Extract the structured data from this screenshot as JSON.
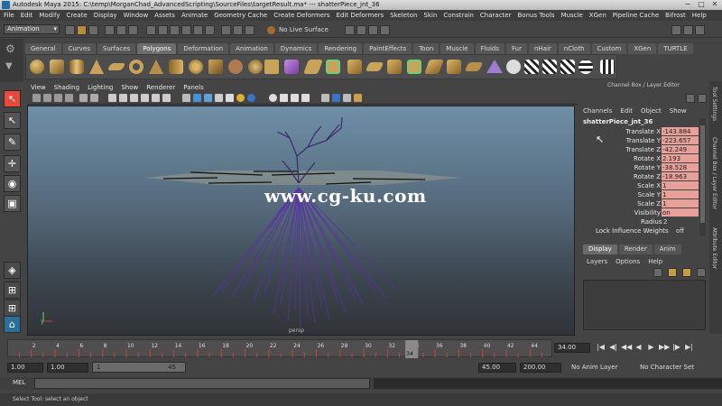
{
  "window": {
    "title": "Autodesk Maya 2015: C:\\temp\\MorganChad_AdvancedScripting\\SourceFiles\\targetResult.ma*  ---  shatterPiece_jnt_36",
    "controls": [
      "−",
      "□",
      "✕"
    ]
  },
  "menubar": [
    "File",
    "Edit",
    "Modify",
    "Create",
    "Display",
    "Window",
    "Assets",
    "Animate",
    "Geometry Cache",
    "Create Deformers",
    "Edit Deformers",
    "Skeleton",
    "Skin",
    "Constrain",
    "Character",
    "Bonus Tools",
    "Muscle",
    "XGen",
    "Pipeline Cache",
    "Bifrost",
    "Help"
  ],
  "statusline": {
    "mode": "Animation",
    "live_surface": "No Live Surface"
  },
  "shelf": {
    "tabs": [
      "General",
      "Curves",
      "Surfaces",
      "Polygons",
      "Deformation",
      "Animation",
      "Dynamics",
      "Rendering",
      "PaintEffects",
      "Toon",
      "Muscle",
      "Fluids",
      "Fur",
      "nHair",
      "nCloth",
      "Custom",
      "XGen",
      "TURTLE"
    ],
    "active_tab": "Polygons"
  },
  "viewport": {
    "menu": [
      "View",
      "Shading",
      "Lighting",
      "Show",
      "Renderer",
      "Panels"
    ],
    "camera": "persp",
    "watermark": "www.cg-ku.com"
  },
  "channel_box": {
    "title": "Channel Box / Layer Editor",
    "menu": [
      "Channels",
      "Edit",
      "Object",
      "Show"
    ],
    "object": "shatterPiece_jnt_36",
    "channels": [
      {
        "label": "Translate X",
        "value": "-143.884",
        "keyed": true
      },
      {
        "label": "Translate Y",
        "value": "-223.657",
        "keyed": true
      },
      {
        "label": "Translate Z",
        "value": "-42.249",
        "keyed": true
      },
      {
        "label": "Rotate X",
        "value": "2.193",
        "keyed": true
      },
      {
        "label": "Rotate Y",
        "value": "-38.528",
        "keyed": true
      },
      {
        "label": "Rotate Z",
        "value": "-18.963",
        "keyed": true
      },
      {
        "label": "Scale X",
        "value": "1",
        "keyed": true
      },
      {
        "label": "Scale Y",
        "value": "1",
        "keyed": true
      },
      {
        "label": "Scale Z",
        "value": "1",
        "keyed": true
      },
      {
        "label": "Visibility",
        "value": "on",
        "keyed": true
      },
      {
        "label": "Radius",
        "value": "2",
        "keyed": false
      },
      {
        "label": "Lock Influence Weights",
        "value": "off",
        "keyed": false
      }
    ]
  },
  "layer_editor": {
    "tabs": [
      "Display",
      "Render",
      "Anim"
    ],
    "active_tab": "Display",
    "menu": [
      "Layers",
      "Options",
      "Help"
    ]
  },
  "side_tabs": [
    "Tool Settings",
    "Channel Box / Layer Editor",
    "Attribute Editor"
  ],
  "timeline": {
    "ticks": [
      "2",
      "4",
      "6",
      "8",
      "10",
      "12",
      "14",
      "16",
      "18",
      "20",
      "22",
      "24",
      "26",
      "28",
      "30",
      "32",
      "34",
      "36",
      "38",
      "40",
      "42",
      "44"
    ],
    "current_frame": "34",
    "current_field": "34.00",
    "playback": [
      "|◀",
      "◀|",
      "◀◀",
      "◀",
      "▶",
      "▶▶",
      "|▶",
      "▶|"
    ]
  },
  "range": {
    "start": "1.00",
    "anim_start": "1.00",
    "slider_start": "1",
    "slider_end": "45",
    "end": "45.00",
    "anim_end": "200.00",
    "anim_layer": "No Anim Layer",
    "character_set": "No Character Set"
  },
  "command_line": {
    "label": "MEL"
  },
  "help_line": "Select Tool: select an object",
  "colors": {
    "keyed_channel": "#e8a09a",
    "viewport_top": "#6e8fa7",
    "viewport_bottom": "#303438",
    "joints": "#5b2fa8"
  }
}
